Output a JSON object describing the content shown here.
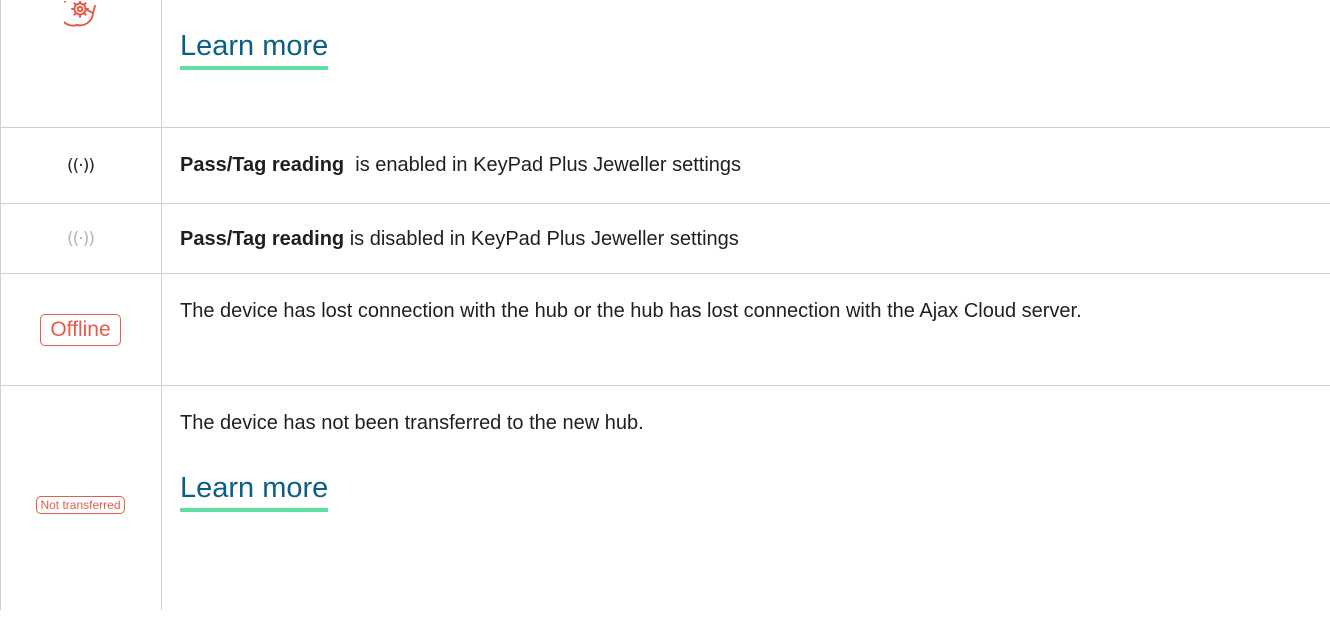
{
  "rows": [
    {
      "icon": "gear-refresh-icon",
      "link_text": "Learn more"
    },
    {
      "icon": "radio-waves-icon",
      "bold": "Pass/Tag reading",
      "text": "  is enabled in KeyPad Plus Jeweller settings"
    },
    {
      "icon": "radio-waves-disabled-icon",
      "bold": "Pass/Tag reading",
      "text": " is disabled in KeyPad Plus Jeweller settings"
    },
    {
      "badge": "Offline",
      "text": "The device has lost connection with the hub or the hub has lost connection with the Ajax Cloud server."
    },
    {
      "badge": "Not transferred",
      "text": "The device has not been transferred to the new hub.",
      "link_text": "Learn more"
    }
  ],
  "colors": {
    "accent_red": "#e45c4c",
    "link": "#0b5f86",
    "link_underline": "#5fe0a2",
    "border": "#cfcfcf"
  }
}
